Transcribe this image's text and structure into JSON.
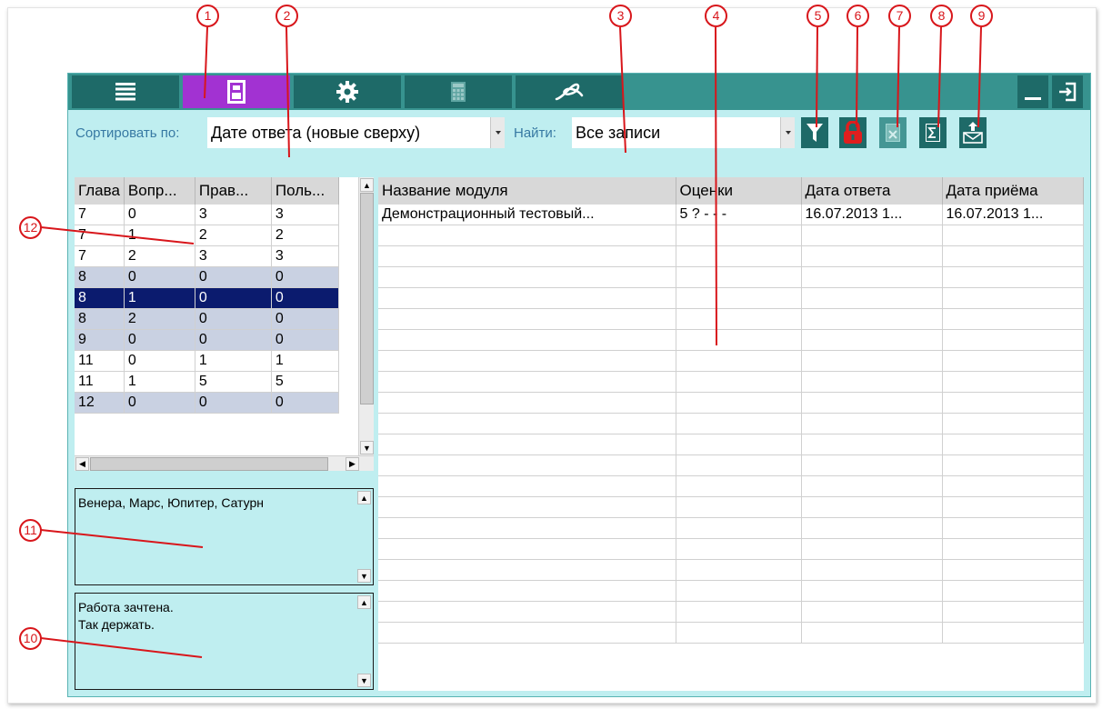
{
  "callouts": [
    "1",
    "2",
    "3",
    "4",
    "5",
    "6",
    "7",
    "8",
    "9",
    "10",
    "11",
    "12"
  ],
  "nav_tabs": [
    {
      "icon": "list-icon"
    },
    {
      "icon": "user-card-icon",
      "active": true
    },
    {
      "icon": "gear-icon"
    },
    {
      "icon": "calculator-icon"
    },
    {
      "icon": "signature-logo-icon"
    }
  ],
  "window_buttons": [
    {
      "icon": "minimize-icon"
    },
    {
      "icon": "exit-icon"
    }
  ],
  "toolbar": {
    "sort_label": "Сортировать по:",
    "sort_value": "Дате ответа (новые сверху)",
    "find_label": "Найти:",
    "find_value": "Все записи",
    "buttons": [
      {
        "icon": "filter-icon"
      },
      {
        "icon": "lock-icon",
        "color": "#e01e1e"
      },
      {
        "icon": "delete-icon"
      },
      {
        "icon": "sum-report-icon"
      },
      {
        "icon": "send-mail-icon"
      }
    ]
  },
  "left_grid": {
    "columns": [
      "Глава",
      "Вопр...",
      "Прав...",
      "Поль..."
    ],
    "rows": [
      {
        "cells": [
          "7",
          "0",
          "3",
          "3"
        ],
        "style": "normal"
      },
      {
        "cells": [
          "7",
          "1",
          "2",
          "2"
        ],
        "style": "normal"
      },
      {
        "cells": [
          "7",
          "2",
          "3",
          "3"
        ],
        "style": "normal"
      },
      {
        "cells": [
          "8",
          "0",
          "0",
          "0"
        ],
        "style": "alt"
      },
      {
        "cells": [
          "8",
          "1",
          "0",
          "0"
        ],
        "style": "selected"
      },
      {
        "cells": [
          "8",
          "2",
          "0",
          "0"
        ],
        "style": "alt"
      },
      {
        "cells": [
          "9",
          "0",
          "0",
          "0"
        ],
        "style": "alt"
      },
      {
        "cells": [
          "11",
          "0",
          "1",
          "1"
        ],
        "style": "normal"
      },
      {
        "cells": [
          "11",
          "1",
          "5",
          "5"
        ],
        "style": "normal"
      },
      {
        "cells": [
          "12",
          "0",
          "0",
          "0"
        ],
        "style": "alt"
      }
    ]
  },
  "answer_memo": "Венера, Марс, Юпитер, Сатурн",
  "comment_memo": [
    "Работа зачтена.",
    "Так держать."
  ],
  "main_grid": {
    "columns": [
      "Название модуля",
      "Оценки",
      "Дата ответа",
      "Дата приёма"
    ],
    "rows": [
      [
        "Демонстрационный тестовый...",
        "5 ? - - -",
        "16.07.2013 1...",
        "16.07.2013 1..."
      ]
    ],
    "empty_rows": 20
  },
  "colors": {
    "accent": "#a232d2",
    "bar": "#37938f",
    "tab": "#1e6a68",
    "panel": "#bfeef0",
    "selected": "#0b1b6e",
    "alt_row": "#c9d1e2",
    "callout": "#d8161b"
  }
}
